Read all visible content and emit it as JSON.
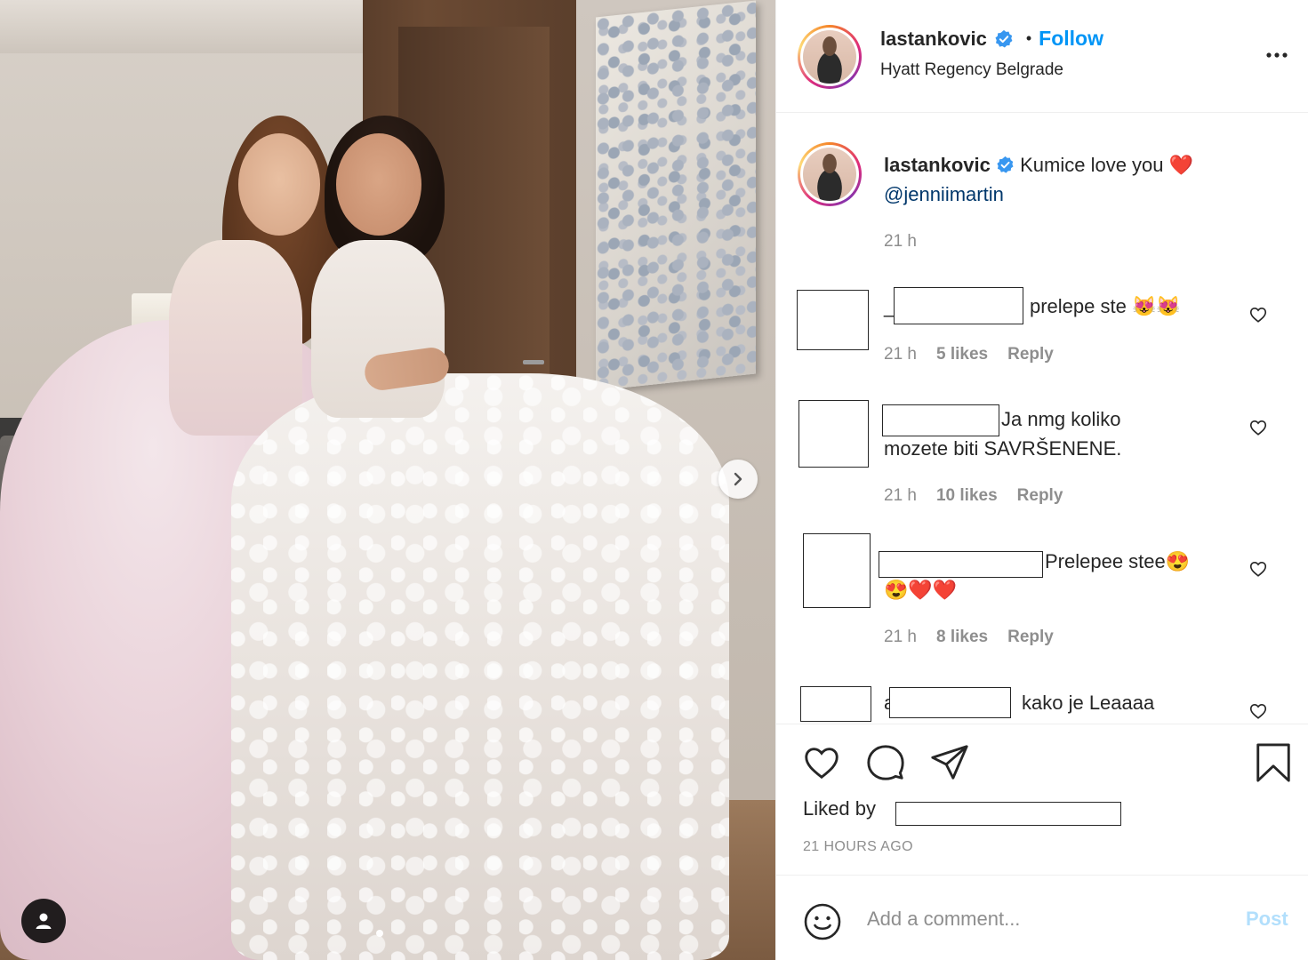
{
  "post": {
    "username": "lastankovic",
    "follow_label": "Follow",
    "separator": "•",
    "location": "Hyatt Regency Belgrade",
    "caption": {
      "username": "lastankovic",
      "text": "Kumice love you ❤️",
      "mention": "@jenniimartin",
      "time": "21 h"
    },
    "comments": [
      {
        "prefix": "_",
        "text": "prelepe ste 😻😻",
        "time": "21 h",
        "likes": "5 likes",
        "reply": "Reply"
      },
      {
        "prefix": "",
        "text": " Ja nmg koliko",
        "text2": "mozete biti SAVRŠENENE.",
        "time": "21 h",
        "likes": "10 likes",
        "reply": "Reply"
      },
      {
        "prefix": "",
        "text": "Prelepee stee😍",
        "text2": "😍❤️❤️",
        "time": "21 h",
        "likes": "8 likes",
        "reply": "Reply"
      },
      {
        "prefix": "a",
        "text": "kako je Leaaaa"
      }
    ],
    "liked_by_label": "Liked by",
    "time_ago": "21 HOURS AGO",
    "add_comment_placeholder": "Add a comment...",
    "post_label": "Post"
  },
  "icons": {
    "verified": "verified-badge-icon",
    "more": "more-options-icon",
    "like": "heart-icon",
    "comment": "comment-bubble-icon",
    "share": "paper-plane-icon",
    "save": "bookmark-icon",
    "emoji": "smiley-icon",
    "next": "chevron-right-icon",
    "tags": "user-tag-icon"
  },
  "colors": {
    "follow": "#0095f6",
    "verified": "#3897f0",
    "post_disabled": "#b2dffc",
    "muted": "#8e8e8e"
  },
  "carousel": {
    "current": 1,
    "total": 1
  }
}
